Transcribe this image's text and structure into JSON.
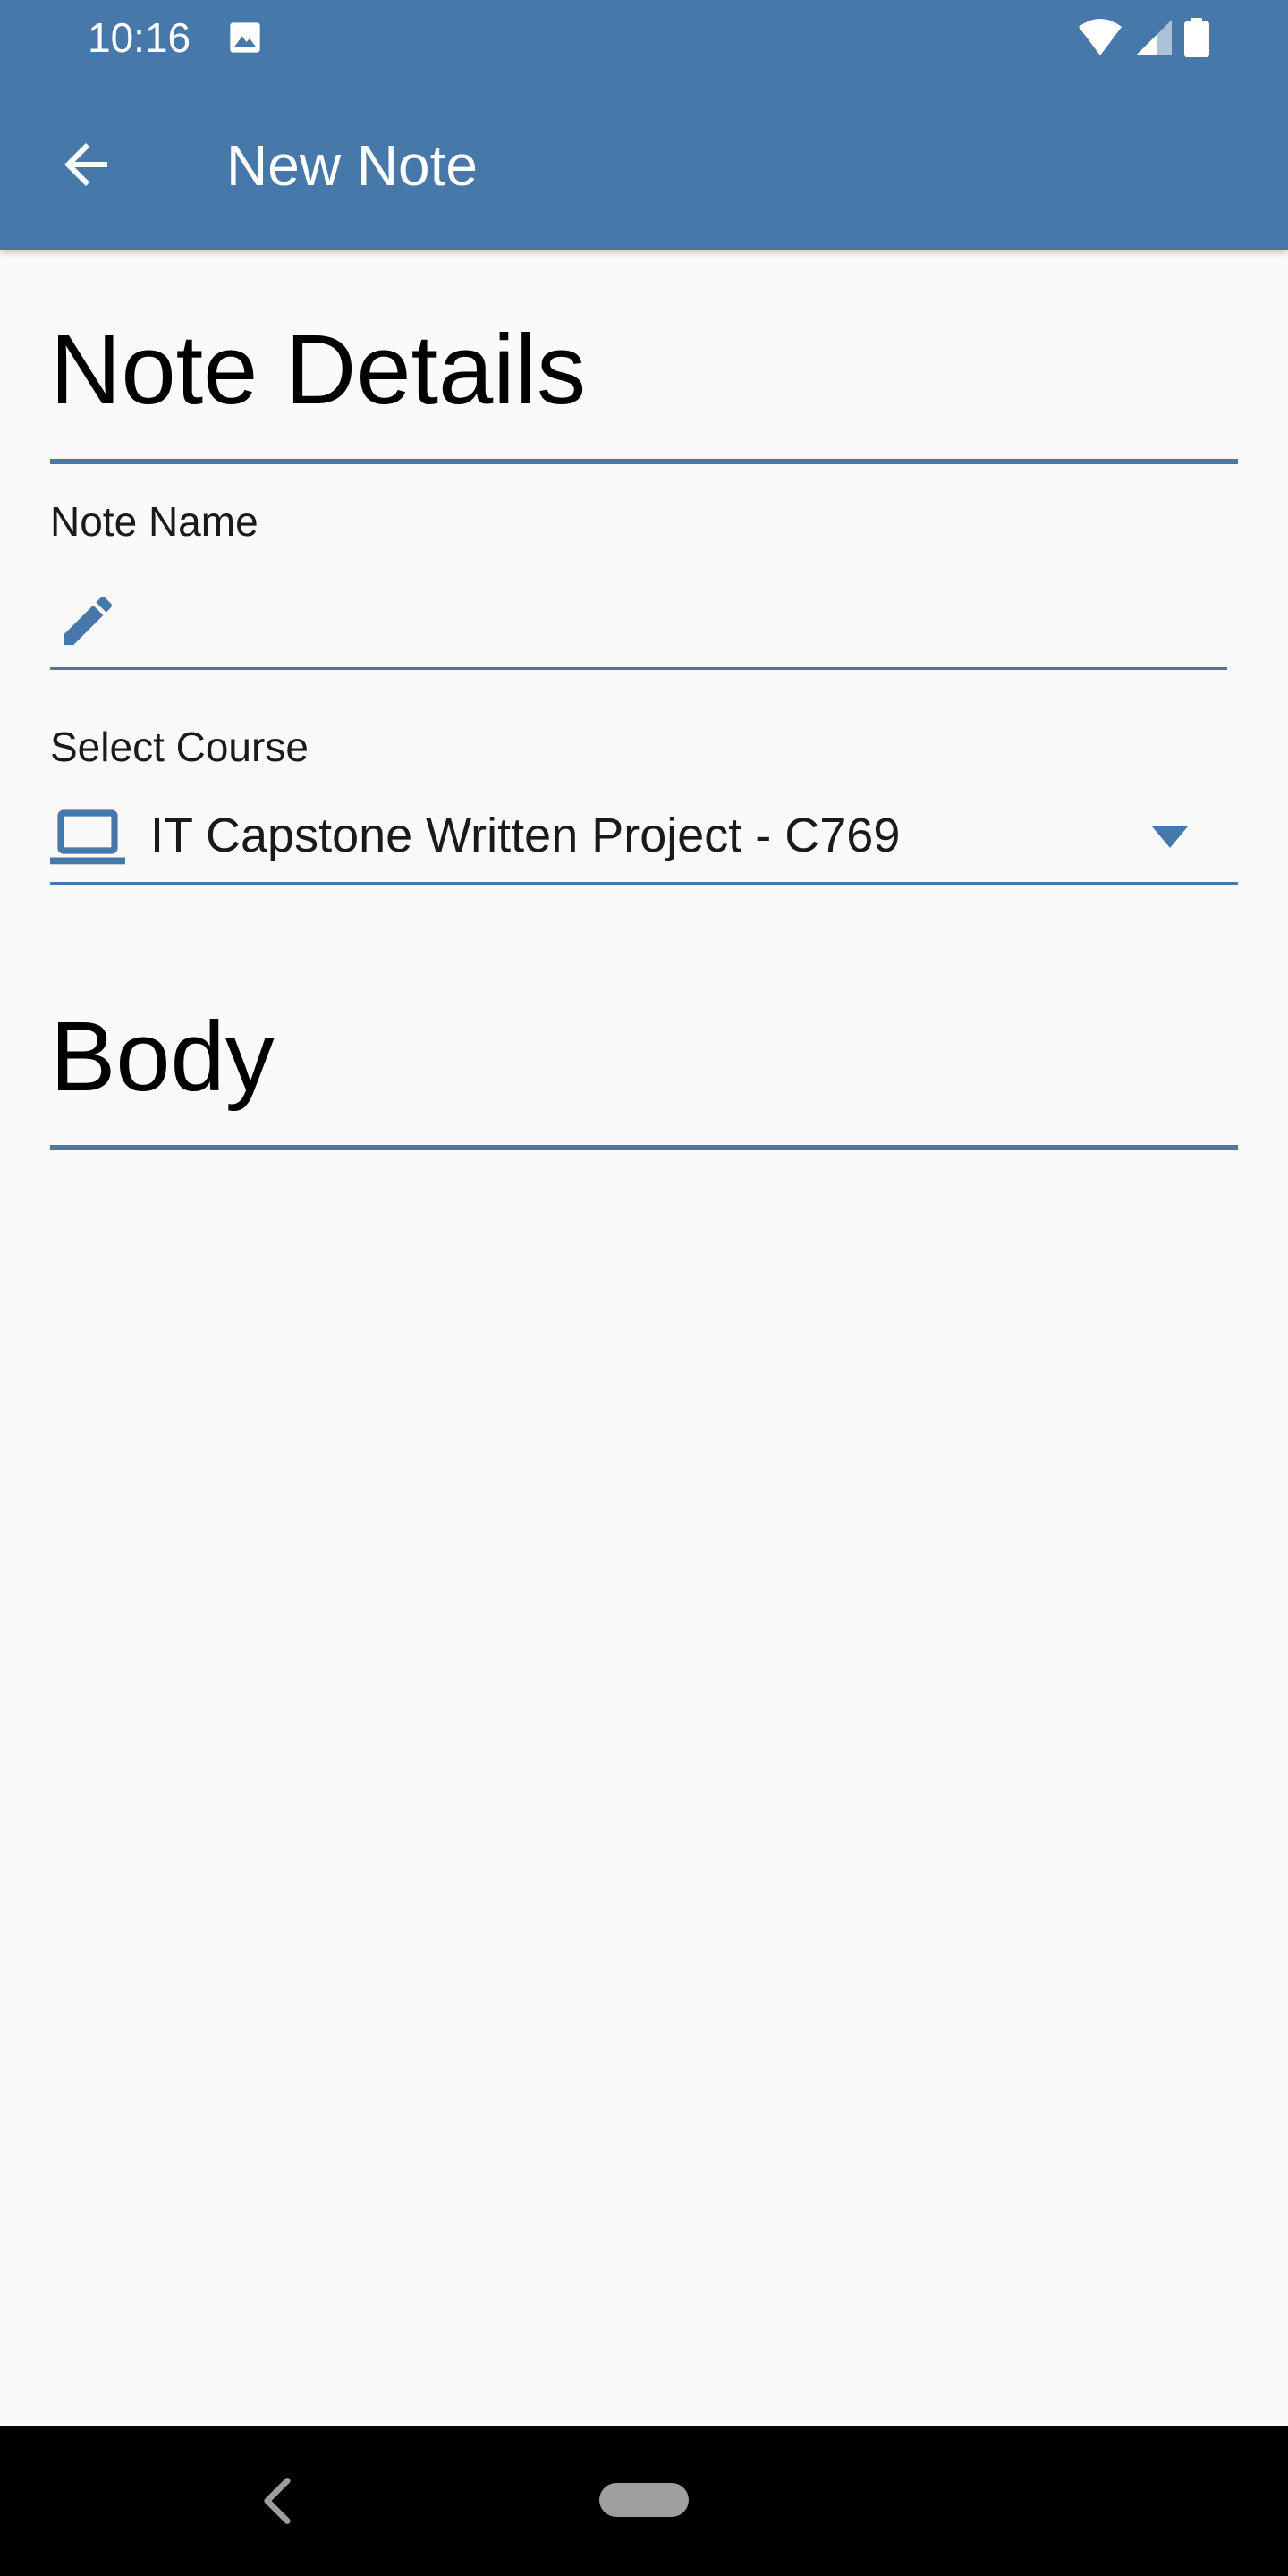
{
  "status_bar": {
    "time": "10:16",
    "icons": [
      "image-icon",
      "wifi-icon",
      "cell-signal-icon",
      "battery-icon"
    ]
  },
  "app_bar": {
    "title": "New Note",
    "back_icon": "arrow-back-icon"
  },
  "note_details": {
    "heading": "Note Details",
    "note_name": {
      "label": "Note Name",
      "value": "",
      "placeholder": "",
      "icon": "pencil-icon"
    },
    "course": {
      "label": "Select Course",
      "selected": "IT Capstone Written Project - C769",
      "icon": "laptop-icon"
    }
  },
  "body_section": {
    "heading": "Body"
  },
  "nav_bar": {
    "icons": [
      "nav-back-icon",
      "home-pill"
    ]
  },
  "colors": {
    "primary": "#4678a9",
    "background": "#fafafa",
    "nav_bar": "#000000"
  }
}
